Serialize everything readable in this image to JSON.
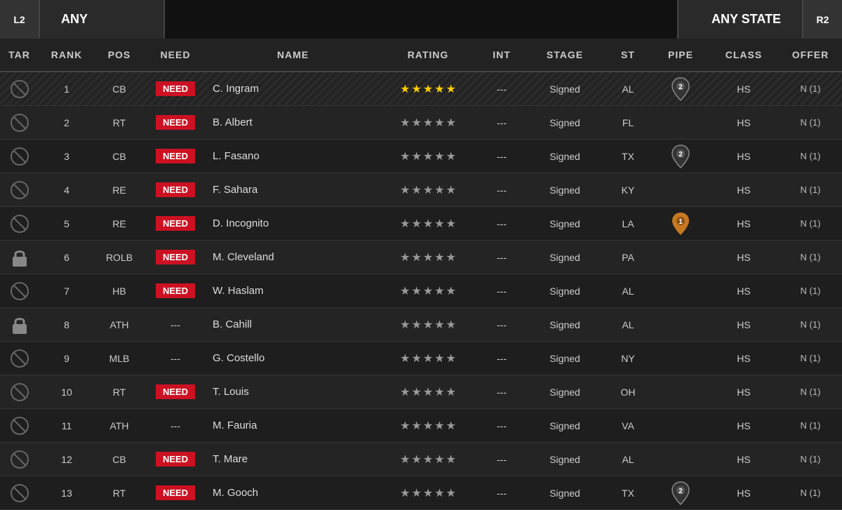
{
  "topBar": {
    "leftTrigger": "L2",
    "filterLabel": "ANY",
    "rightTrigger": "R2",
    "stateLabel": "ANY STATE"
  },
  "columns": [
    "TAR",
    "RANK",
    "POS",
    "NEED",
    "NAME",
    "RATING",
    "INT",
    "STAGE",
    "ST",
    "PIPE",
    "CLASS",
    "OFFER"
  ],
  "rows": [
    {
      "tar": "no",
      "rank": "1",
      "pos": "CB",
      "need": "Need",
      "name": "C. Ingram",
      "stars": 5,
      "goldStars": 5,
      "int": "---",
      "stage": "Signed",
      "st": "AL",
      "pipe": "pin-dark-2",
      "class": "HS",
      "offer": "N (1)",
      "highlighted": true
    },
    {
      "tar": "no",
      "rank": "2",
      "pos": "RT",
      "need": "Need",
      "name": "B. Albert",
      "stars": 5,
      "goldStars": 0,
      "int": "---",
      "stage": "Signed",
      "st": "FL",
      "pipe": "",
      "class": "HS",
      "offer": "N (1)"
    },
    {
      "tar": "no",
      "rank": "3",
      "pos": "CB",
      "need": "Need",
      "name": "L. Fasano",
      "stars": 5,
      "goldStars": 0,
      "int": "---",
      "stage": "Signed",
      "st": "TX",
      "pipe": "pin-dark-2",
      "class": "HS",
      "offer": "N (1)"
    },
    {
      "tar": "no",
      "rank": "4",
      "pos": "RE",
      "need": "Need",
      "name": "F. Sahara",
      "stars": 5,
      "goldStars": 0,
      "int": "---",
      "stage": "Signed",
      "st": "KY",
      "pipe": "",
      "class": "HS",
      "offer": "N (1)"
    },
    {
      "tar": "no",
      "rank": "5",
      "pos": "RE",
      "need": "Need",
      "name": "D. Incognito",
      "stars": 5,
      "goldStars": 0,
      "int": "---",
      "stage": "Signed",
      "st": "LA",
      "pipe": "pin-orange-1",
      "class": "HS",
      "offer": "N (1)"
    },
    {
      "tar": "lock",
      "rank": "6",
      "pos": "ROLB",
      "need": "Need",
      "name": "M. Cleveland",
      "stars": 5,
      "goldStars": 0,
      "int": "---",
      "stage": "Signed",
      "st": "PA",
      "pipe": "",
      "class": "HS",
      "offer": "N (1)"
    },
    {
      "tar": "no",
      "rank": "7",
      "pos": "HB",
      "need": "Need",
      "name": "W. Haslam",
      "stars": 5,
      "goldStars": 0,
      "int": "---",
      "stage": "Signed",
      "st": "AL",
      "pipe": "",
      "class": "HS",
      "offer": "N (1)"
    },
    {
      "tar": "lock",
      "rank": "8",
      "pos": "ATH",
      "need": "---",
      "name": "B. Cahill",
      "stars": 5,
      "goldStars": 0,
      "int": "---",
      "stage": "Signed",
      "st": "AL",
      "pipe": "",
      "class": "HS",
      "offer": "N (1)"
    },
    {
      "tar": "no",
      "rank": "9",
      "pos": "MLB",
      "need": "---",
      "name": "G. Costello",
      "stars": 5,
      "goldStars": 0,
      "int": "---",
      "stage": "Signed",
      "st": "NY",
      "pipe": "",
      "class": "HS",
      "offer": "N (1)"
    },
    {
      "tar": "no",
      "rank": "10",
      "pos": "RT",
      "need": "Need",
      "name": "T. Louis",
      "stars": 5,
      "goldStars": 0,
      "int": "---",
      "stage": "Signed",
      "st": "OH",
      "pipe": "",
      "class": "HS",
      "offer": "N (1)"
    },
    {
      "tar": "no",
      "rank": "11",
      "pos": "ATH",
      "need": "---",
      "name": "M. Fauria",
      "stars": 5,
      "goldStars": 0,
      "int": "---",
      "stage": "Signed",
      "st": "VA",
      "pipe": "",
      "class": "HS",
      "offer": "N (1)"
    },
    {
      "tar": "no",
      "rank": "12",
      "pos": "CB",
      "need": "Need",
      "name": "T. Mare",
      "stars": 5,
      "goldStars": 0,
      "int": "---",
      "stage": "Signed",
      "st": "AL",
      "pipe": "",
      "class": "HS",
      "offer": "N (1)"
    },
    {
      "tar": "no",
      "rank": "13",
      "pos": "RT",
      "need": "Need",
      "name": "M. Gooch",
      "stars": 5,
      "goldStars": 0,
      "int": "---",
      "stage": "Signed",
      "st": "TX",
      "pipe": "pin-dark-2",
      "class": "HS",
      "offer": "N (1)"
    }
  ]
}
